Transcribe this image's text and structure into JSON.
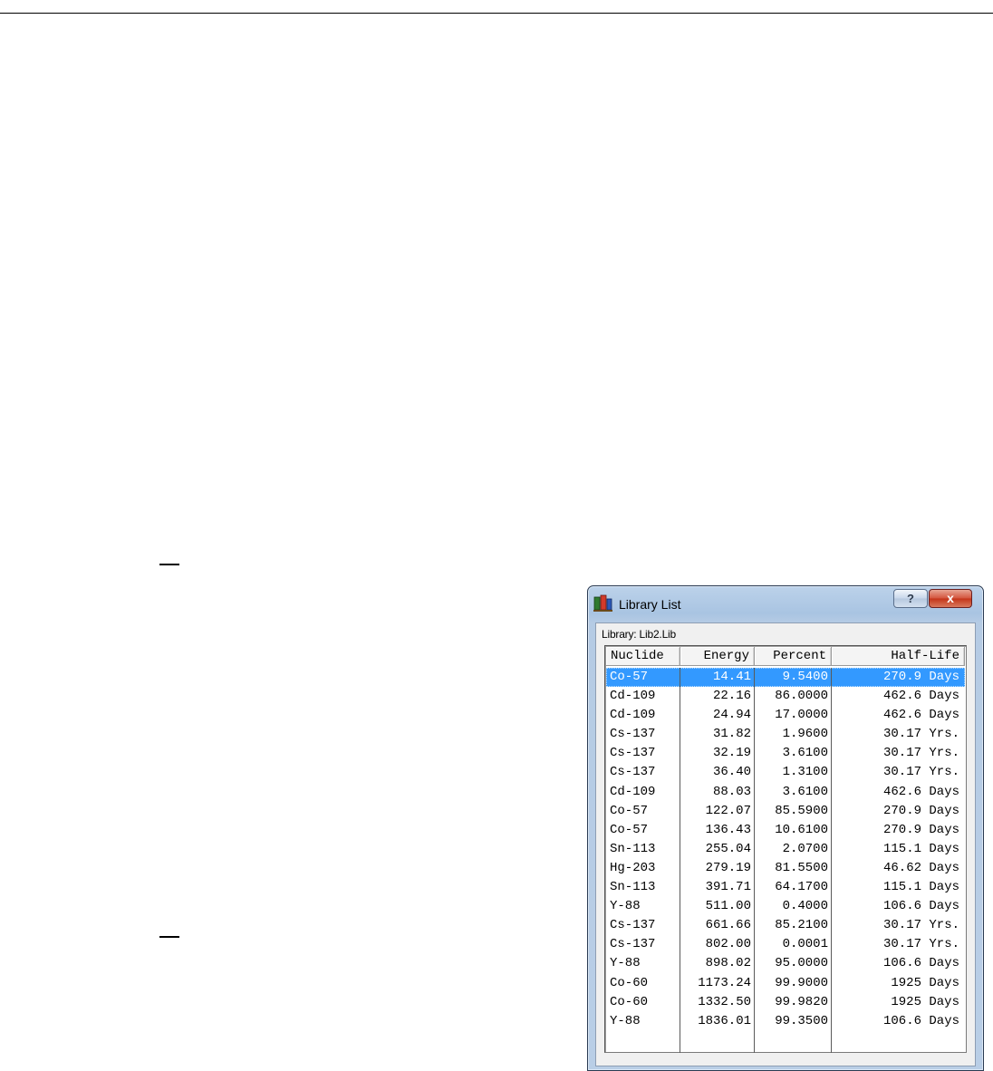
{
  "window": {
    "title": "Library List",
    "help_label": "?",
    "close_label": "x"
  },
  "library_label": "Library: Lib2.Lib",
  "columns": [
    "Nuclide",
    "Energy",
    "Percent",
    "Half-Life"
  ],
  "rows": [
    {
      "nuclide": "Co-57",
      "energy": "14.41",
      "percent": "9.5400",
      "half_life": "270.9 Days",
      "selected": true
    },
    {
      "nuclide": "Cd-109",
      "energy": "22.16",
      "percent": "86.0000",
      "half_life": "462.6 Days"
    },
    {
      "nuclide": "Cd-109",
      "energy": "24.94",
      "percent": "17.0000",
      "half_life": "462.6 Days"
    },
    {
      "nuclide": "Cs-137",
      "energy": "31.82",
      "percent": "1.9600",
      "half_life": "30.17 Yrs."
    },
    {
      "nuclide": "Cs-137",
      "energy": "32.19",
      "percent": "3.6100",
      "half_life": "30.17 Yrs."
    },
    {
      "nuclide": "Cs-137",
      "energy": "36.40",
      "percent": "1.3100",
      "half_life": "30.17 Yrs."
    },
    {
      "nuclide": "Cd-109",
      "energy": "88.03",
      "percent": "3.6100",
      "half_life": "462.6 Days"
    },
    {
      "nuclide": "Co-57",
      "energy": "122.07",
      "percent": "85.5900",
      "half_life": "270.9 Days"
    },
    {
      "nuclide": "Co-57",
      "energy": "136.43",
      "percent": "10.6100",
      "half_life": "270.9 Days"
    },
    {
      "nuclide": "Sn-113",
      "energy": "255.04",
      "percent": "2.0700",
      "half_life": "115.1 Days"
    },
    {
      "nuclide": "Hg-203",
      "energy": "279.19",
      "percent": "81.5500",
      "half_life": "46.62 Days"
    },
    {
      "nuclide": "Sn-113",
      "energy": "391.71",
      "percent": "64.1700",
      "half_life": "115.1 Days"
    },
    {
      "nuclide": "Y-88",
      "energy": "511.00",
      "percent": "0.4000",
      "half_life": "106.6 Days"
    },
    {
      "nuclide": "Cs-137",
      "energy": "661.66",
      "percent": "85.2100",
      "half_life": "30.17 Yrs."
    },
    {
      "nuclide": "Cs-137",
      "energy": "802.00",
      "percent": "0.0001",
      "half_life": "30.17 Yrs."
    },
    {
      "nuclide": "Y-88",
      "energy": "898.02",
      "percent": "95.0000",
      "half_life": "106.6 Days"
    },
    {
      "nuclide": "Co-60",
      "energy": "1173.24",
      "percent": "99.9000",
      "half_life": "1925 Days"
    },
    {
      "nuclide": "Co-60",
      "energy": "1332.50",
      "percent": "99.9820",
      "half_life": "1925 Days"
    },
    {
      "nuclide": "Y-88",
      "energy": "1836.01",
      "percent": "99.3500",
      "half_life": "106.6 Days"
    }
  ],
  "icons": {
    "app": "library-app-icon",
    "help": "help-icon",
    "close": "close-icon"
  },
  "colors": {
    "selection": "#3399ff",
    "close_button": "#c43318"
  }
}
